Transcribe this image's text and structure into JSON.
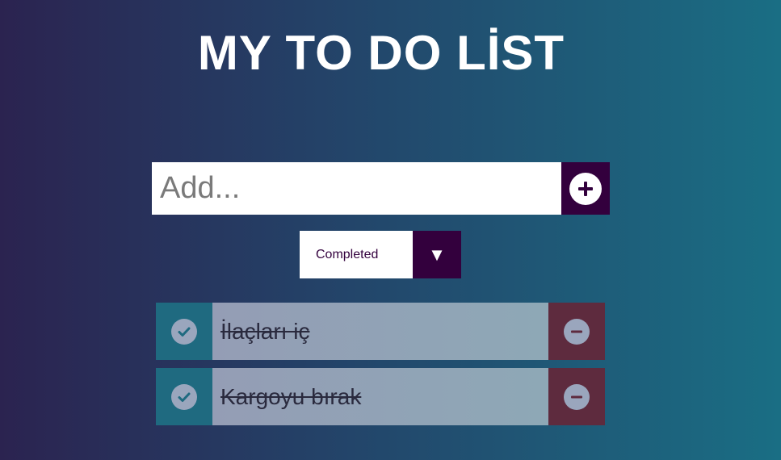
{
  "header": {
    "title": "MY TO DO LİST"
  },
  "add_form": {
    "placeholder": "Add...",
    "add_icon": "plus-circle-icon"
  },
  "filter": {
    "selected": "Completed",
    "arrow": "▼"
  },
  "todos": [
    {
      "text": "İlaçları iç",
      "completed": true,
      "check_icon": "check-circle-icon",
      "delete_icon": "minus-circle-icon"
    },
    {
      "text": "Kargoyu bırak",
      "completed": true,
      "check_icon": "check-circle-icon",
      "delete_icon": "minus-circle-icon"
    }
  ],
  "colors": {
    "accent": "#33003d",
    "check_bg": "#1f6a80",
    "delete_bg": "#5e2b3e"
  }
}
